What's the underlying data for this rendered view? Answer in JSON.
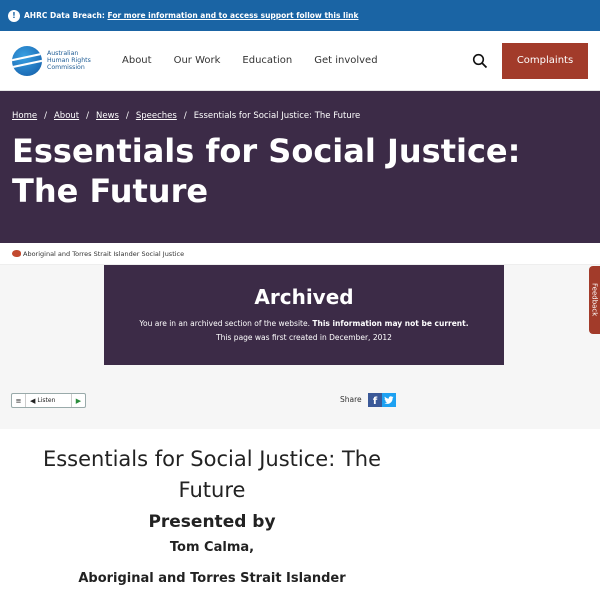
{
  "alert": {
    "icon": "info-icon",
    "prefix": "AHRC Data Breach:",
    "link_text": "For more information and to access support follow this link"
  },
  "header": {
    "logo_lines": [
      "Australian",
      "Human Rights",
      "Commission"
    ],
    "nav": [
      "About",
      "Our Work",
      "Education",
      "Get involved"
    ],
    "search_icon": "search-icon",
    "complaints_label": "Complaints",
    "complaints_color": "#a23b2a"
  },
  "hero": {
    "breadcrumb": [
      "Home",
      "About",
      "News",
      "Speeches"
    ],
    "breadcrumb_current": "Essentials for Social Justice: The Future",
    "title": "Essentials for Social Justice: The Future",
    "bg_color": "#3c2b47"
  },
  "tag": {
    "icon": "australia-map-icon",
    "label": "Aboriginal and Torres Strait Islander Social Justice"
  },
  "archived": {
    "title": "Archived",
    "line1_normal": "You are in an archived section of the website. ",
    "line1_bold": "This information may not be current.",
    "line2": "This page was first created in December, 2012"
  },
  "feedback": {
    "label": "Feedback"
  },
  "listen": {
    "label": "Listen",
    "menu_icon": "menu-icon",
    "speaker_icon": "speaker-icon",
    "play_icon": "play-icon"
  },
  "share": {
    "label": "Share",
    "facebook": "f",
    "twitter": "t"
  },
  "article": {
    "title": "Essentials for Social Justice: The Future",
    "presented_by": "Presented by",
    "speaker": "Tom Calma,",
    "role": "Aboriginal and Torres Strait Islander"
  }
}
